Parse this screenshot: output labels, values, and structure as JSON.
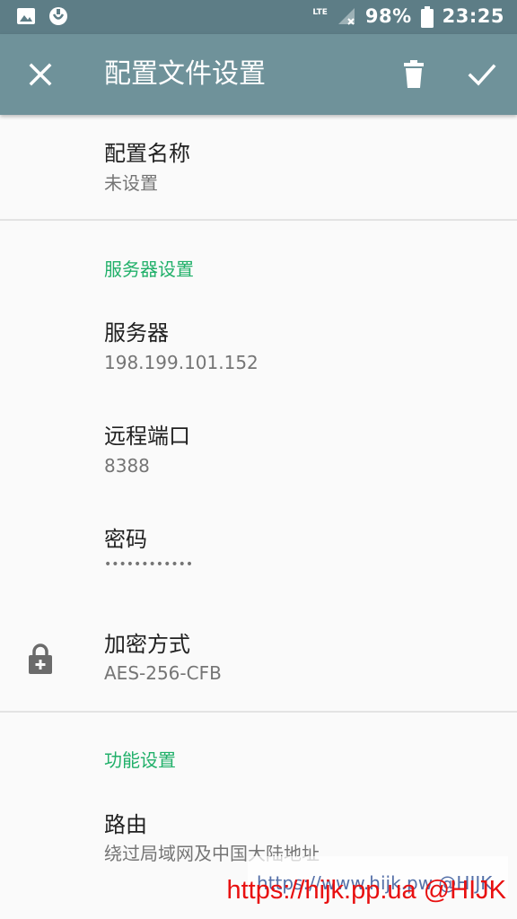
{
  "status_bar": {
    "network": "LTE",
    "battery": "98%",
    "time": "23:25",
    "icons": [
      "image-icon",
      "smile-app-icon",
      "signal-icon",
      "battery-icon"
    ]
  },
  "toolbar": {
    "title": "配置文件设置",
    "close_icon": "close-icon",
    "delete_icon": "trash-icon",
    "save_icon": "check-icon"
  },
  "profile": {
    "name_title": "配置名称",
    "name_value": "未设置"
  },
  "server_section": {
    "header": "服务器设置",
    "server_title": "服务器",
    "server_value": "198.199.101.152",
    "port_title": "远程端口",
    "port_value": "8388",
    "password_title": "密码",
    "password_value": "••••••••••••",
    "method_title": "加密方式",
    "method_value": "AES-256-CFB",
    "method_icon": "lock-plus-icon"
  },
  "feature_section": {
    "header": "功能设置",
    "route_title": "路由",
    "route_value": "绕过局域网及中国大陆地址"
  },
  "watermarks": {
    "overlay": "https://www.hijk.pw @HIJK",
    "red": "https://hijk.pp.ua @HIJK"
  },
  "colors": {
    "status_bar": "#5d7d86",
    "toolbar": "#6f929a",
    "accent": "#21b06a",
    "watermark_red": "#e81010"
  }
}
